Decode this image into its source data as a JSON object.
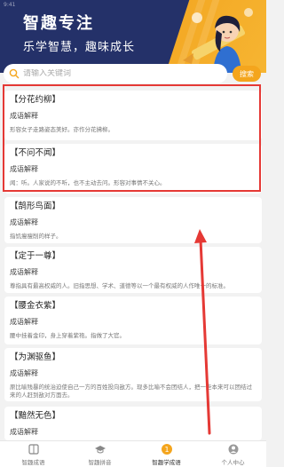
{
  "status_bar": {
    "text": "9:41"
  },
  "banner": {
    "title": "智趣专注",
    "subtitle": "乐学智慧，趣味成长"
  },
  "search": {
    "placeholder": "请输入关键词",
    "button_label": "搜索"
  },
  "items": [
    {
      "title": "【分花约柳】",
      "label": "成语解释",
      "desc": "形容女子走路姿态美好。亦作分花拂柳。"
    },
    {
      "title": "【不问不闻】",
      "label": "成语解释",
      "desc": "闻：听。人家说的不听，也不主动去问。形容对事情不关心。"
    },
    {
      "title": "【鹄形鸟面】",
      "label": "成语解释",
      "desc": "指饥瘦瘦削的样子。"
    },
    {
      "title": "【定于一尊】",
      "label": "成语解释",
      "desc": "尊指具有最高权威的人。旧指思想、学术、道德等以一个最有权威的人作唯一的标准。"
    },
    {
      "title": "【腰金衣紫】",
      "label": "成语解释",
      "desc": "腰中挂着金印，身上穿着紫袍。指做了大官。"
    },
    {
      "title": "【为渊驱鱼】",
      "label": "成语解释",
      "desc": "原比喻残暴的统治迫使自己一方的百姓投向敌方。现多比喻不会团结人，把一些本来可以团结过来的人赶到敌对方面去。"
    },
    {
      "title": "【黯然无色】",
      "label": "成语解释",
      "desc": ""
    }
  ],
  "tabs": [
    {
      "label": "智趣成语",
      "icon": "book-icon",
      "active": false
    },
    {
      "label": "智趣拼音",
      "icon": "mortarboard-icon",
      "active": false
    },
    {
      "label": "智趣学成语",
      "icon": "badge-icon",
      "active": true
    },
    {
      "label": "个人中心",
      "icon": "user-icon",
      "active": false
    }
  ],
  "colors": {
    "accent": "#f4a51d",
    "banner_dark": "#243169",
    "highlight": "#e53935"
  }
}
